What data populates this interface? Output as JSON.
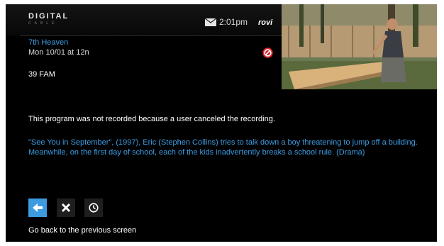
{
  "header": {
    "brand": "DIGITAL",
    "brand_sub": "CABLE",
    "time": "2:01pm",
    "guide_logo": "rovi",
    "mail_icon": "mail-icon"
  },
  "program": {
    "title": "7th Heaven",
    "airing": "Mon 10/01 at 12n",
    "channel": "39 FAM",
    "status_icon": "cancel-icon"
  },
  "message": {
    "status": "This program was not recorded because a user canceled the recording.",
    "description": "\"See You in September\", (1997), Eric (Stephen Collins) tries to talk down a boy threatening to jump off a building. Meanwhile, on the first day of school, each of the kids inadvertently breaks a school rule. (Drama)"
  },
  "actions": [
    {
      "name": "back",
      "icon": "back-arrow-icon"
    },
    {
      "name": "delete",
      "icon": "close-icon"
    },
    {
      "name": "schedule",
      "icon": "clock-icon"
    }
  ],
  "hint": "Go back to the previous screen",
  "colors": {
    "accent": "#3d9be0",
    "background": "#000000",
    "button": "#1e1e1e",
    "cancel_red": "#e0252a"
  }
}
